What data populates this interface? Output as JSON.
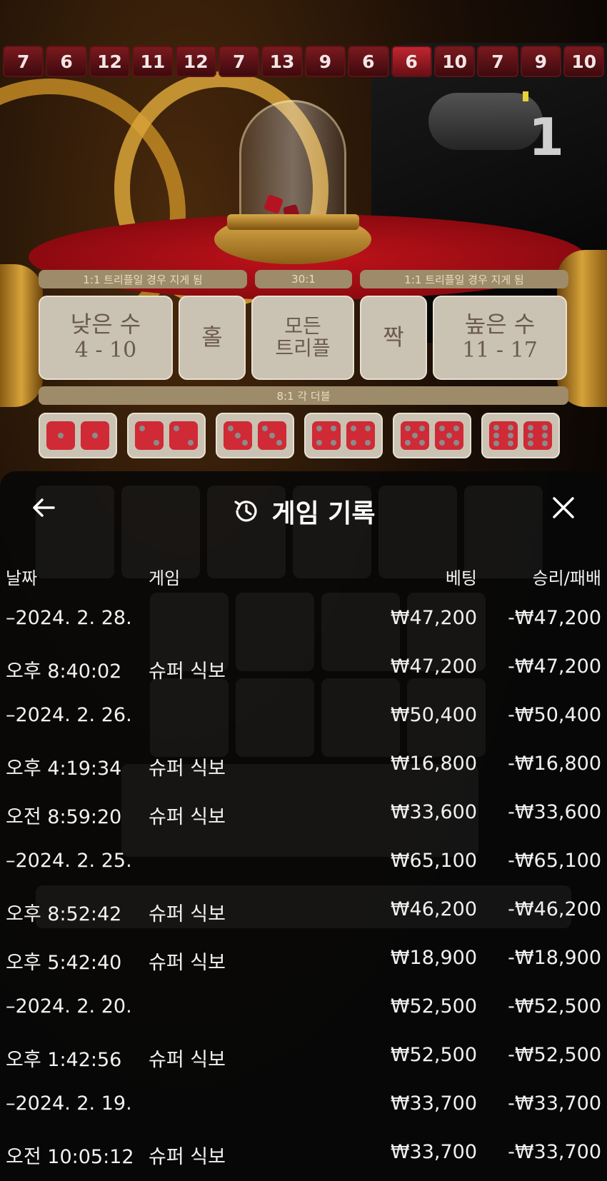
{
  "history_strip": [
    "7",
    "6",
    "12",
    "11",
    "12",
    "7",
    "13",
    "9",
    "6",
    "6",
    "10",
    "7",
    "9",
    "10"
  ],
  "round_number": "1",
  "board": {
    "pay_left": "1:1 트리플일 경우 지게 됨",
    "pay_mid": "30:1",
    "pay_right": "1:1 트리플일 경우 지게 됨",
    "small_label": "낮은 수",
    "small_range": "4 - 10",
    "odd_label": "홀",
    "triple_label_1": "모든",
    "triple_label_2": "트리플",
    "even_label": "짝",
    "big_label": "높은 수",
    "big_range": "11 - 17",
    "pair_pay": "8:1 각 더블",
    "pairs": [
      1,
      2,
      3,
      4,
      5,
      6
    ]
  },
  "panel": {
    "title": "게임 기록",
    "back_icon": "arrow-left-icon",
    "history_icon": "history-clock-icon",
    "close_icon": "close-icon"
  },
  "columns": {
    "date": "날짜",
    "game": "게임",
    "bet": "베팅",
    "result": "승리/패배"
  },
  "rows": [
    {
      "date": "–2024. 2. 28.",
      "game": "",
      "bet": "₩47,200",
      "result": "-₩47,200"
    },
    {
      "date": "오후 8:40:02",
      "game": "슈퍼 식보",
      "bet": "₩47,200",
      "result": "-₩47,200"
    },
    {
      "date": "–2024. 2. 26.",
      "game": "",
      "bet": "₩50,400",
      "result": "-₩50,400"
    },
    {
      "date": "오후 4:19:34",
      "game": "슈퍼 식보",
      "bet": "₩16,800",
      "result": "-₩16,800"
    },
    {
      "date": "오전 8:59:20",
      "game": "슈퍼 식보",
      "bet": "₩33,600",
      "result": "-₩33,600"
    },
    {
      "date": "–2024. 2. 25.",
      "game": "",
      "bet": "₩65,100",
      "result": "-₩65,100"
    },
    {
      "date": "오후 8:52:42",
      "game": "슈퍼 식보",
      "bet": "₩46,200",
      "result": "-₩46,200"
    },
    {
      "date": "오후 5:42:40",
      "game": "슈퍼 식보",
      "bet": "₩18,900",
      "result": "-₩18,900"
    },
    {
      "date": "–2024. 2. 20.",
      "game": "",
      "bet": "₩52,500",
      "result": "-₩52,500"
    },
    {
      "date": "오후 1:42:56",
      "game": "슈퍼 식보",
      "bet": "₩52,500",
      "result": "-₩52,500"
    },
    {
      "date": "–2024. 2. 19.",
      "game": "",
      "bet": "₩33,700",
      "result": "-₩33,700"
    },
    {
      "date": "오전 10:05:12",
      "game": "슈퍼 식보",
      "bet": "₩33,700",
      "result": "-₩33,700"
    }
  ]
}
